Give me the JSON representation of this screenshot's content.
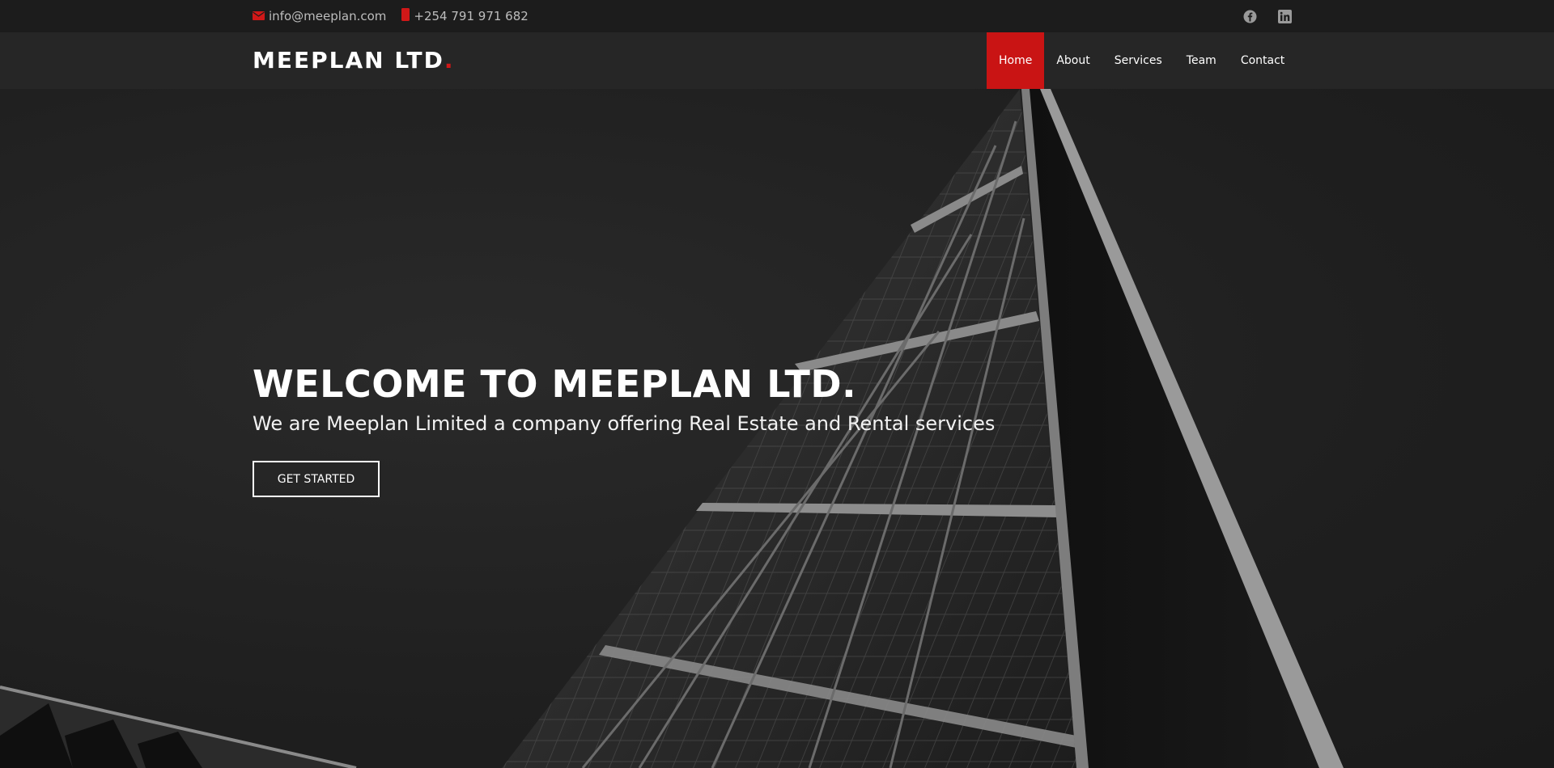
{
  "topbar": {
    "email": "info@meeplan.com",
    "phone": "+254 791 971 682",
    "social": [
      {
        "name": "facebook-icon"
      },
      {
        "name": "linkedin-icon"
      }
    ]
  },
  "header": {
    "logo": "MEEPLAN LTD",
    "logo_dot": ".",
    "nav": [
      {
        "label": "Home",
        "active": true
      },
      {
        "label": "About"
      },
      {
        "label": "Services"
      },
      {
        "label": "Team"
      },
      {
        "label": "Contact"
      }
    ]
  },
  "hero": {
    "title": "WELCOME TO MEEPLAN LTD.",
    "subtitle": "We are Meeplan Limited a company offering Real Estate and Rental services",
    "button": "GET STARTED"
  },
  "colors": {
    "accent": "#c91414",
    "topbar": "#1c1c1c",
    "header": "#262626"
  }
}
